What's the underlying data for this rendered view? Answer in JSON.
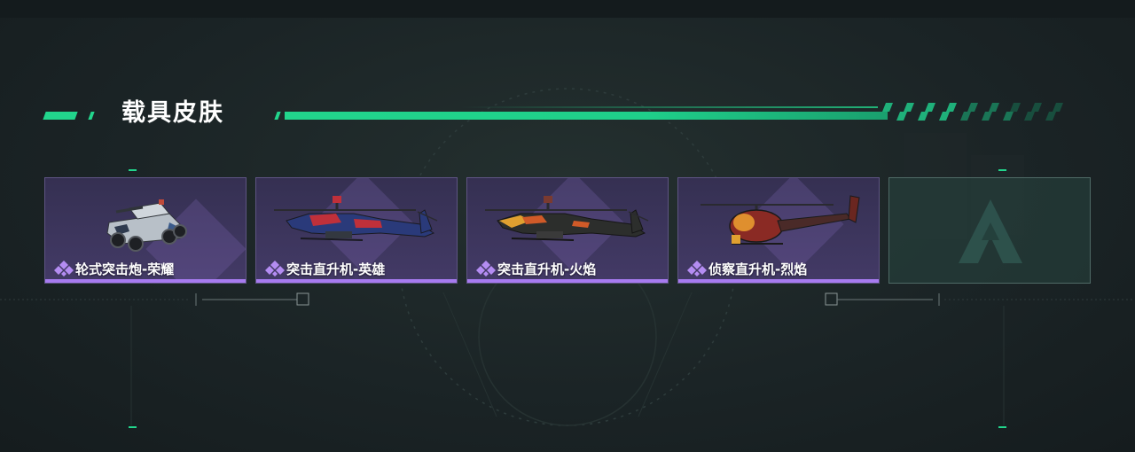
{
  "section": {
    "title": "载具皮肤"
  },
  "colors": {
    "accent": "#22d58c",
    "card_bg_top": "#353052",
    "card_bg_bottom": "#433a66",
    "card_underline": "#a77bf0",
    "rarity": "#b48cf2"
  },
  "skins": [
    {
      "name": "轮式突击炮-荣耀",
      "vehicle_icon": "armored-car-icon",
      "rarity_icon": "purple-diamond-icon"
    },
    {
      "name": "突击直升机-英雄",
      "vehicle_icon": "attack-helicopter-hero-icon",
      "rarity_icon": "purple-diamond-icon"
    },
    {
      "name": "突击直升机-火焰",
      "vehicle_icon": "attack-helicopter-flame-icon",
      "rarity_icon": "purple-diamond-icon"
    },
    {
      "name": "侦察直升机-烈焰",
      "vehicle_icon": "scout-helicopter-icon",
      "rarity_icon": "purple-diamond-icon"
    }
  ],
  "empty_slot": {
    "icon": "game-logo-icon"
  }
}
